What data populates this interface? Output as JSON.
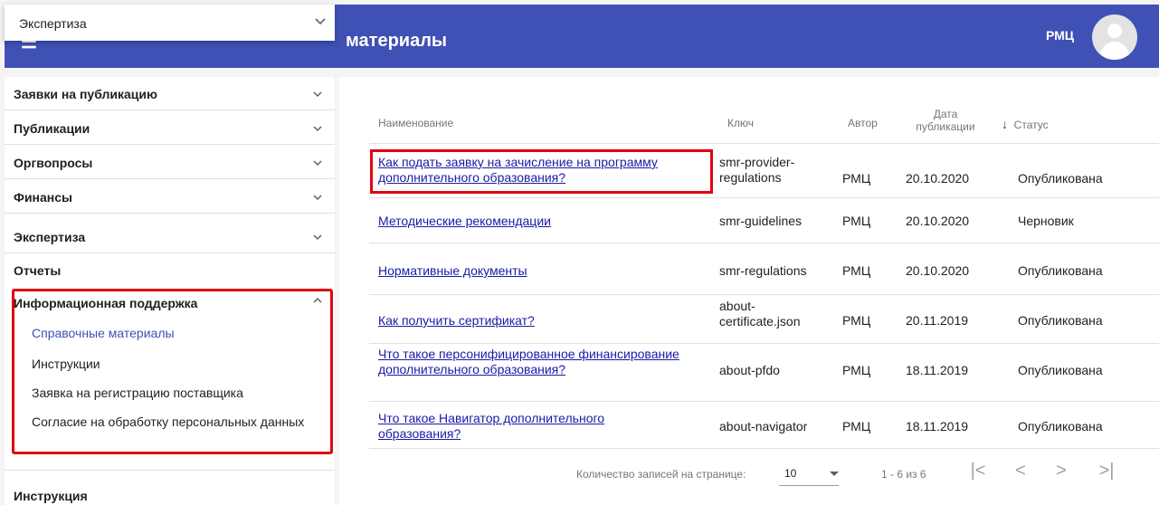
{
  "header": {
    "title": "материалы",
    "user_name": "РМЦ"
  },
  "dropdown": {
    "label": "Экспертиза"
  },
  "sidebar": {
    "items": [
      {
        "label": "Заявки на публикацию"
      },
      {
        "label": "Публикации"
      },
      {
        "label": "Оргвопросы"
      },
      {
        "label": "Финансы"
      },
      {
        "label": "Экспертиза"
      },
      {
        "label": "Отчеты"
      },
      {
        "label": "Информационная поддержка"
      }
    ],
    "sub_items": [
      {
        "label": "Справочные материалы"
      },
      {
        "label": "Инструкции"
      },
      {
        "label": "Заявка на регистрацию поставщика"
      },
      {
        "label": "Согласие на обработку персональных данных"
      }
    ],
    "bottom_item": "Инструкция"
  },
  "table": {
    "headers": {
      "name": "Наименование",
      "key": "Ключ",
      "author": "Автор",
      "date": "Дата публикации",
      "status": "Статус"
    },
    "rows": [
      {
        "name": "Как подать заявку на зачисление на программу дополнительного образования?",
        "key": "smr-provider-regulations",
        "author": "РМЦ",
        "date": "20.10.2020",
        "status": "Опубликована"
      },
      {
        "name": "Методические рекомендации",
        "key": "smr-guidelines",
        "author": "РМЦ",
        "date": "20.10.2020",
        "status": "Черновик"
      },
      {
        "name": "Нормативные документы",
        "key": "smr-regulations",
        "author": "РМЦ",
        "date": "20.10.2020",
        "status": "Опубликована"
      },
      {
        "name": "Как получить сертификат?",
        "key": "about-certificate.json",
        "author": "РМЦ",
        "date": "20.11.2019",
        "status": "Опубликована"
      },
      {
        "name": "Что такое персонифицированное финансирование дополнительного образования?",
        "key": "about-pfdo",
        "author": "РМЦ",
        "date": "18.11.2019",
        "status": "Опубликована"
      },
      {
        "name": "Что такое Навигатор дополнительного образования?",
        "key": "about-navigator",
        "author": "РМЦ",
        "date": "18.11.2019",
        "status": "Опубликована"
      }
    ]
  },
  "pagination": {
    "rows_per_page_label": "Количество записей на странице:",
    "rows_per_page_value": "10",
    "range_text": "1 - 6 из 6"
  },
  "colors": {
    "header_bg": "#3f51b5",
    "highlight": "#e3000f",
    "link": "#1a1aa6",
    "active_sub": "#3f51b5"
  }
}
